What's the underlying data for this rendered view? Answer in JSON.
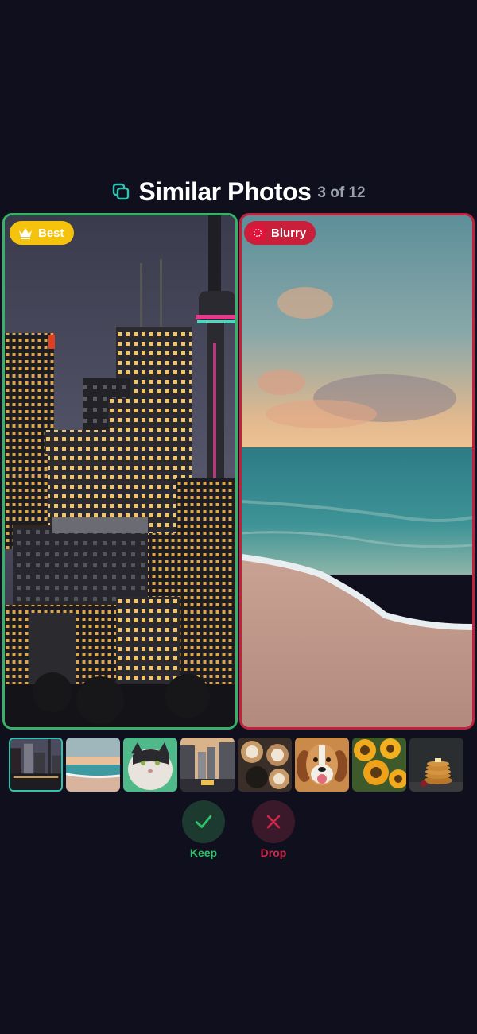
{
  "header": {
    "icon": "copy-icon",
    "title": "Similar Photos",
    "counter": "3 of 12"
  },
  "left_photo": {
    "badge_label": "Best",
    "badge_icon": "crown-icon",
    "border_color": "#37b169",
    "subject": "city-skyline-photo"
  },
  "right_photo": {
    "badge_label": "Blurry",
    "badge_icon": "blur-icon",
    "border_color": "#c2213d",
    "subject": "beach-sunset-photo"
  },
  "thumbnails": [
    {
      "subject": "city-skyline",
      "selected": true
    },
    {
      "subject": "beach-sunset",
      "selected": false
    },
    {
      "subject": "cat",
      "selected": false
    },
    {
      "subject": "city-street",
      "selected": false
    },
    {
      "subject": "coffee-cups",
      "selected": false
    },
    {
      "subject": "beagle-dog",
      "selected": false
    },
    {
      "subject": "sunflowers",
      "selected": false
    },
    {
      "subject": "pancakes",
      "selected": false
    }
  ],
  "actions": {
    "keep_label": "Keep",
    "drop_label": "Drop"
  },
  "colors": {
    "background": "#0f0f1e",
    "keep": "#2fc36a",
    "drop": "#d0274a",
    "best_badge": "#f5c20e",
    "selected_thumb": "#2fc3b0"
  }
}
